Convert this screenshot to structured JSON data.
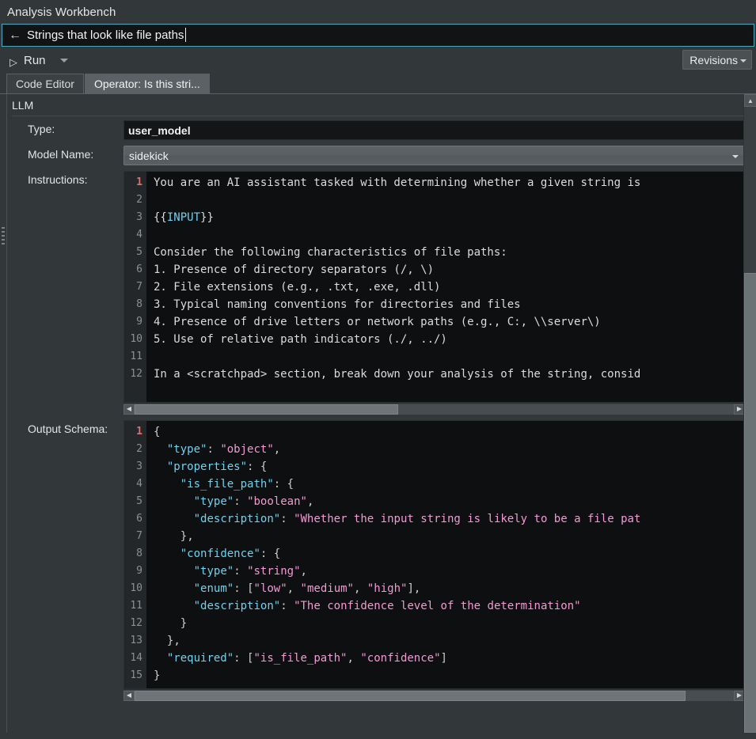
{
  "window": {
    "title": "Analysis Workbench"
  },
  "namebar": {
    "back_icon": "back-arrow-icon",
    "value": "Strings that look like file paths"
  },
  "toolbar": {
    "run_label": "Run",
    "run_icon": "play-icon",
    "run_menu_icon": "chevron-down-icon",
    "revisions_label": "Revisions",
    "revisions_icon": "chevron-down-icon"
  },
  "tabs": [
    {
      "label": "Code Editor",
      "active": false
    },
    {
      "label": "Operator: Is this stri...",
      "active": true
    }
  ],
  "panel": {
    "group_label": "LLM",
    "fields": {
      "type": {
        "label": "Type:",
        "value": "user_model"
      },
      "model_name": {
        "label": "Model Name:",
        "value": "sidekick",
        "dropdown_icon": "chevron-down-icon"
      },
      "instructions": {
        "label": "Instructions:"
      },
      "output_schema": {
        "label": "Output Schema:"
      }
    }
  },
  "instructions_editor": {
    "line_numbers": [
      "1",
      "2",
      "3",
      "4",
      "5",
      "6",
      "7",
      "8",
      "9",
      "10",
      "11",
      "12"
    ],
    "active_line": 1,
    "lines": [
      "You are an AI assistant tasked with determining whether a given string is",
      "",
      "{{INPUT}}",
      "",
      "Consider the following characteristics of file paths:",
      "1. Presence of directory separators (/, \\)",
      "2. File extensions (e.g., .txt, .exe, .dll)",
      "3. Typical naming conventions for directories and files",
      "4. Presence of drive letters or network paths (e.g., C:, \\\\server\\)",
      "5. Use of relative path indicators (./, ../)",
      "",
      "In a <scratchpad> section, break down your analysis of the string, consid"
    ],
    "hscroll": {
      "left_arrow": "scroll-left-icon",
      "right_arrow": "scroll-right-icon",
      "thumb_percent": 44
    }
  },
  "schema_editor": {
    "line_numbers": [
      "1",
      "2",
      "3",
      "4",
      "5",
      "6",
      "7",
      "8",
      "9",
      "10",
      "11",
      "12",
      "13",
      "14",
      "15"
    ],
    "active_line": 1,
    "lines": [
      "{",
      "  \"type\": \"object\",",
      "  \"properties\": {",
      "    \"is_file_path\": {",
      "      \"type\": \"boolean\",",
      "      \"description\": \"Whether the input string is likely to be a file pat",
      "    },",
      "    \"confidence\": {",
      "      \"type\": \"string\",",
      "      \"enum\": [\"low\", \"medium\", \"high\"],",
      "      \"description\": \"The confidence level of the determination\"",
      "    }",
      "  },",
      "  \"required\": [\"is_file_path\", \"confidence\"]",
      "}"
    ],
    "hscroll": {
      "left_arrow": "scroll-left-icon",
      "right_arrow": "scroll-right-icon",
      "thumb_percent": 92
    }
  },
  "panel_scrollbar": {
    "up_arrow": "scroll-up-icon",
    "thumb_top_percent": 28,
    "thumb_height_percent": 72
  },
  "colors": {
    "accent": "#4fa8c0",
    "background": "#32383a",
    "editor_background": "#0d0f10",
    "json_key": "#6fd2ef",
    "json_string": "#f39ad4",
    "active_line_number": "#d4736e"
  }
}
